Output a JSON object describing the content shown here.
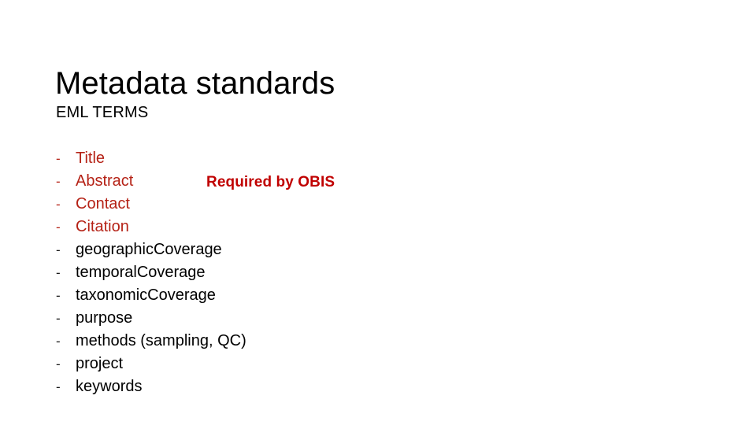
{
  "slide": {
    "title": "Metadata standards",
    "subhead": "EML TERMS",
    "callout": "Required by OBIS",
    "bullet_marker": "-",
    "colors": {
      "required_red": "#b52216",
      "callout_red": "#c00000",
      "body_black": "#000000",
      "background": "#ffffff"
    },
    "terms": [
      {
        "label": "Title",
        "required": true
      },
      {
        "label": "Abstract",
        "required": true
      },
      {
        "label": "Contact",
        "required": true
      },
      {
        "label": "Citation",
        "required": true
      },
      {
        "label": "geographicCoverage",
        "required": false
      },
      {
        "label": "temporalCoverage",
        "required": false
      },
      {
        "label": "taxonomicCoverage",
        "required": false
      },
      {
        "label": "purpose",
        "required": false
      },
      {
        "label": "methods (sampling, QC)",
        "required": false
      },
      {
        "label": "project",
        "required": false
      },
      {
        "label": "keywords",
        "required": false
      }
    ]
  }
}
